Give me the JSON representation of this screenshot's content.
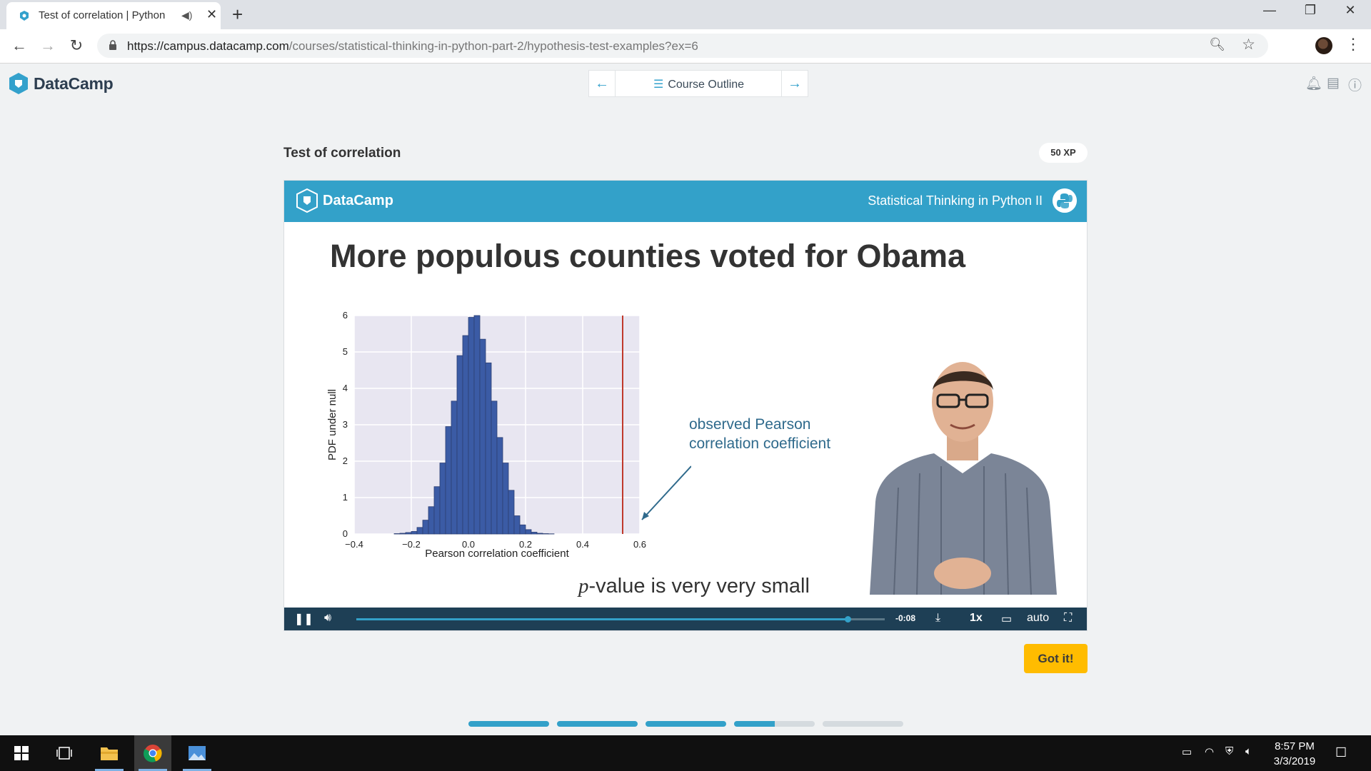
{
  "browser": {
    "tab_title": "Test of correlation | Python",
    "audio_icon": "speaker-icon",
    "url_host": "https://campus.datacamp.com",
    "url_path": "/courses/statistical-thinking-in-python-part-2/hypothesis-test-examples?ex=6"
  },
  "header": {
    "brand": "DataCamp",
    "outline_label": "Course Outline"
  },
  "exercise": {
    "title": "Test of correlation",
    "xp": "50 XP",
    "got_it": "Got it!"
  },
  "video": {
    "brand": "DataCamp",
    "course": "Statistical Thinking in Python II",
    "slide_title": "More populous counties voted for Obama",
    "annotation_line1": "observed Pearson",
    "annotation_line2": "correlation coefficient",
    "pvalue_italic": "p",
    "pvalue_rest": "-value is very very small",
    "time_remaining": "-0:08",
    "speed": "1x",
    "quality": "auto",
    "played_fraction": 0.93
  },
  "chart_data": {
    "type": "bar",
    "xlabel": "Pearson correlation coefficient",
    "ylabel": "PDF under null",
    "xlim": [
      -0.4,
      0.6
    ],
    "ylim": [
      0,
      6
    ],
    "xticks": [
      "−0.4",
      "−0.2",
      "0.0",
      "0.2",
      "0.4",
      "0.6"
    ],
    "yticks": [
      "0",
      "1",
      "2",
      "3",
      "4",
      "5",
      "6"
    ],
    "bin_width": 0.02,
    "bins": [
      -0.26,
      -0.24,
      -0.22,
      -0.2,
      -0.18,
      -0.16,
      -0.14,
      -0.12,
      -0.1,
      -0.08,
      -0.06,
      -0.04,
      -0.02,
      0.0,
      0.02,
      0.04,
      0.06,
      0.08,
      0.1,
      0.12,
      0.14,
      0.16,
      0.18,
      0.2,
      0.22,
      0.24,
      0.26,
      0.28
    ],
    "values": [
      0.01,
      0.02,
      0.04,
      0.07,
      0.18,
      0.38,
      0.75,
      1.3,
      1.95,
      2.95,
      3.65,
      4.9,
      5.45,
      5.95,
      6.0,
      5.35,
      4.7,
      3.65,
      2.65,
      1.95,
      1.2,
      0.5,
      0.25,
      0.12,
      0.05,
      0.02,
      0.01,
      0.005
    ],
    "observed_line_x": 0.54,
    "colors": {
      "bars": "#3b5ba5",
      "observed": "#c0392b",
      "background": "#e8e6f1"
    }
  },
  "progress_segments": [
    1,
    1,
    1,
    0.5,
    0
  ],
  "taskbar": {
    "time": "8:57 PM",
    "date": "3/3/2019"
  }
}
